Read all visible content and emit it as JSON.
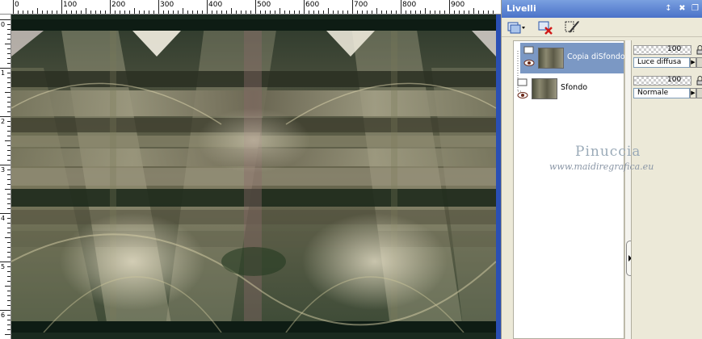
{
  "ruler": {
    "top_labels": [
      "0",
      "100",
      "200",
      "300",
      "400",
      "500",
      "600",
      "700",
      "800",
      "900"
    ],
    "left_labels": [
      "0",
      "1",
      "2",
      "3",
      "4",
      "5",
      "6",
      "7",
      "8"
    ]
  },
  "panel": {
    "title": "Livelli",
    "controls": {
      "pin": "↕",
      "close": "✖",
      "restore": "❐"
    }
  },
  "layers": [
    {
      "name": "Copia diSfondo",
      "opacity": "100",
      "blend": "Luce diffusa",
      "selected": true
    },
    {
      "name": "Sfondo",
      "opacity": "100",
      "blend": "Normale",
      "selected": false
    }
  ],
  "watermark": {
    "name": "Pinuccia",
    "url": "www.maidiregrafica.eu"
  },
  "icons": {
    "new_layer": "new-layer-icon",
    "delete_layer": "delete-layer-icon",
    "edit_mask": "mask-edit-icon",
    "visibility": "eye-icon",
    "lock": "lock-icon"
  },
  "colors": {
    "titlebar": "#4a72c8",
    "selection": "#7b98c4",
    "panel_bg": "#ece9d8"
  }
}
